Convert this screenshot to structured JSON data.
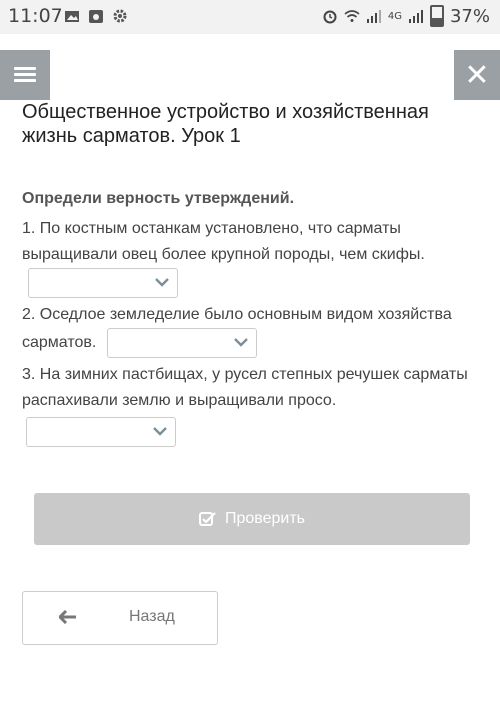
{
  "status": {
    "time": "11:07",
    "network": "4G",
    "battery": "37%"
  },
  "header": {
    "title": "Общественное устройство и хозяйственная жизнь сарматов. Урок 1"
  },
  "task": {
    "instruction": "Определи верность утверждений.",
    "questions": [
      "1. По костным останкам установлено, что сарматы выращивали овец более крупной породы, чем скифы.",
      "2. Оседлое земледелие было основным видом хозяйства сарматов.",
      "3. На зимних пастбищах, у русел степных речушек сарматы распахивали землю и выращивали просо."
    ]
  },
  "buttons": {
    "check": "Проверить",
    "back": "Назад"
  },
  "colors": {
    "toolbar": "#9aa0a3",
    "check_disabled": "#c9c9c9"
  }
}
